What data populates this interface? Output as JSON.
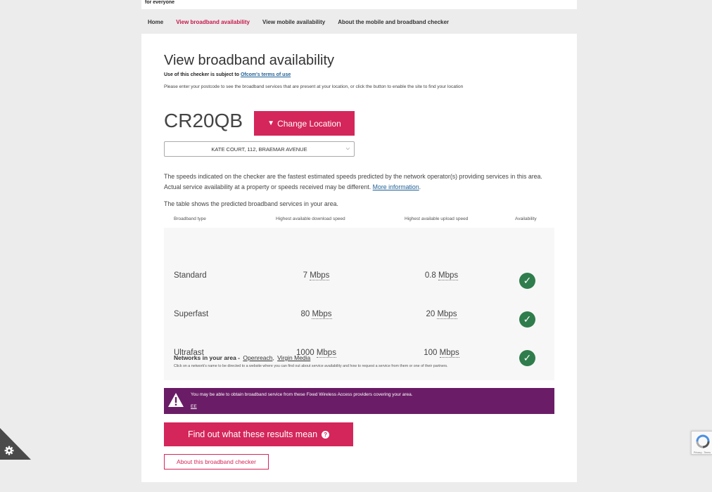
{
  "header": {
    "tagline": "for everyone"
  },
  "nav": [
    {
      "label": "Home",
      "active": false
    },
    {
      "label": "View broadband availability",
      "active": true
    },
    {
      "label": "View mobile availability",
      "active": false
    },
    {
      "label": "About the mobile and broadband checker",
      "active": false
    }
  ],
  "page": {
    "title": "View broadband availability",
    "terms_prefix": "Use of this checker is subject to ",
    "terms_link": "Ofcom's terms of use",
    "instructions": "Please enter your postcode to see the broadband services that are present at your location, or click the button to enable the site to find your location",
    "postcode": "CR20QB",
    "change_location": "Change Location",
    "address_selected": "KATE COURT, 112, BRAEMAR AVENUE",
    "disclaimer": "The speeds indicated on the checker are the fastest estimated speeds predicted by the network operator(s) providing services in this area. Actual service availability at a property or speeds received may be different.",
    "more_info": "More information",
    "table_intro": "The table shows the predicted broadband services in your area."
  },
  "table": {
    "headers": [
      "Broadband type",
      "Highest available download speed",
      "Highest available upload speed",
      "Availability"
    ],
    "rows": [
      {
        "type": "Standard",
        "download": "7",
        "upload": "0.8",
        "unit": "Mbps",
        "available": true
      },
      {
        "type": "Superfast",
        "download": "80",
        "upload": "20",
        "unit": "Mbps",
        "available": true
      },
      {
        "type": "Ultrafast",
        "download": "1000",
        "upload": "100",
        "unit": "Mbps",
        "available": true
      }
    ],
    "networks_label": "Networks in your area - ",
    "networks": [
      "Openreach",
      "Virgin Media"
    ],
    "networks_note": "Click on a network's name to be directed to a website where you can find out about service availability and how to request a service from them or one of their partners."
  },
  "fwa": {
    "message": "You may be able to obtain broadband service from these Fixed Wireless Access providers covering your area.",
    "provider": "EE"
  },
  "buttons": {
    "results": "Find out what these results mean",
    "about": "About this broadband checker"
  },
  "recaptcha": {
    "footer": "Privacy - Terms"
  },
  "colors": {
    "brand": "#d4265a",
    "fwa_bg": "#6a1d66",
    "check": "#2f7d4c",
    "link": "#1d5f95"
  }
}
